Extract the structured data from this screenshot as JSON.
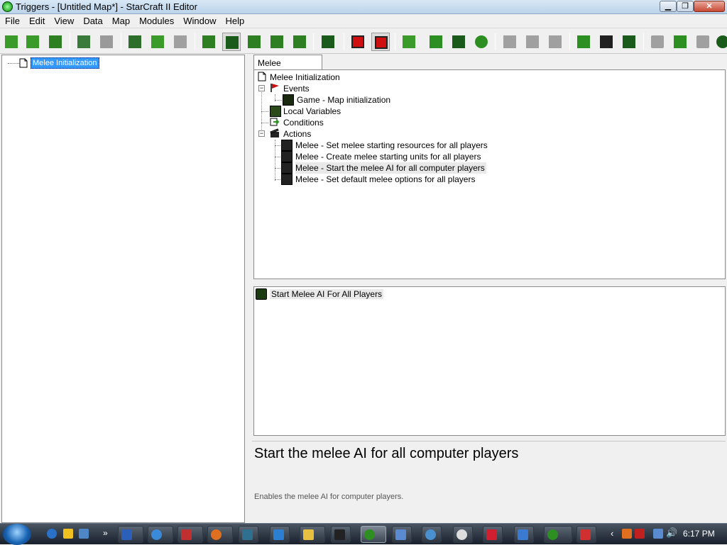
{
  "window": {
    "title": "Triggers - [Untitled Map*] - StarCraft II Editor"
  },
  "menu": [
    "File",
    "Edit",
    "View",
    "Data",
    "Map",
    "Modules",
    "Window",
    "Help"
  ],
  "toolbar": {
    "buttons": [
      {
        "name": "new-trigger",
        "icon": "page-green-icon",
        "color": "#3a9a2a"
      },
      {
        "name": "open",
        "icon": "folder-open-icon",
        "color": "#3a9a2a"
      },
      {
        "name": "save",
        "icon": "disk-save-icon",
        "color": "#2d7f22"
      },
      {
        "name": "undo",
        "icon": "undo-arrow-icon",
        "color": "#3a7a3a"
      },
      {
        "name": "redo",
        "icon": "redo-arrow-icon",
        "color": "#9a9a9a"
      },
      {
        "name": "cut",
        "icon": "scissors-icon",
        "color": "#2d6f2a"
      },
      {
        "name": "copy",
        "icon": "copy-icon",
        "color": "#3a9a2a"
      },
      {
        "name": "paste",
        "icon": "paste-icon",
        "color": "#a0a0a0"
      },
      {
        "name": "terrain",
        "icon": "terrain-icon",
        "color": "#2d7f22"
      },
      {
        "name": "triggers",
        "icon": "trigger-module-icon",
        "color": "#1a5a1a"
      },
      {
        "name": "data",
        "icon": "data-module-icon",
        "color": "#2d7f22"
      },
      {
        "name": "text",
        "icon": "text-a-icon",
        "color": "#2d7f22"
      },
      {
        "name": "import",
        "icon": "import-icon",
        "color": "#2d7f22"
      },
      {
        "name": "ai",
        "icon": "ai-module-icon",
        "color": "#1a5a1a"
      },
      {
        "name": "stop",
        "icon": "stop-red-icon",
        "color": "#d01010"
      },
      {
        "name": "stop-pressed",
        "icon": "stop-red-icon",
        "color": "#d01010"
      },
      {
        "name": "new-element",
        "icon": "page-green-icon",
        "color": "#3a9a2a"
      },
      {
        "name": "new-folder",
        "icon": "folder-icon",
        "color": "#2d8f22"
      },
      {
        "name": "new-action-def",
        "icon": "list-icon",
        "color": "#1a5a1a"
      },
      {
        "name": "new-function",
        "icon": "function-icon",
        "color": "#2d8f22"
      },
      {
        "name": "new-event",
        "icon": "flag-icon",
        "color": "#a0a0a0"
      },
      {
        "name": "new-condition",
        "icon": "arrow-right-icon",
        "color": "#a0a0a0"
      },
      {
        "name": "new-action",
        "icon": "clapper-icon",
        "color": "#a0a0a0"
      },
      {
        "name": "new-local-variable",
        "icon": "variable-arrow-icon",
        "color": "#2d8f22"
      },
      {
        "name": "new-action-clapper",
        "icon": "clapper-dark-icon",
        "color": "#202020"
      },
      {
        "name": "new-param",
        "icon": "param-icon",
        "color": "#1a5a1a"
      },
      {
        "name": "disabled-1",
        "icon": "blank-icon",
        "color": "#a0a0a0"
      },
      {
        "name": "new-comment",
        "icon": "comment-a-icon",
        "color": "#2d8f22"
      },
      {
        "name": "disabled-2",
        "icon": "blank-icon",
        "color": "#a0a0a0"
      },
      {
        "name": "globe",
        "icon": "globe-icon",
        "color": "#1a5a1a"
      }
    ]
  },
  "left_pane": {
    "selected": "Melee Initialization"
  },
  "tab": {
    "label": "Melee Initialization"
  },
  "tree": {
    "root": "Melee Initialization",
    "events_label": "Events",
    "event": "Game - Map initialization",
    "local_variables": "Local Variables",
    "conditions": "Conditions",
    "actions_label": "Actions",
    "actions": [
      "Melee - Set melee starting resources for all players",
      "Melee - Create melee starting units for all players",
      "Melee - Start the melee AI for all computer players",
      "Melee - Set default melee options for all players"
    ]
  },
  "element": {
    "label": "Start Melee AI For All Players"
  },
  "description": {
    "title": "Start the melee AI for all computer players",
    "text": "Enables the melee AI for computer players."
  },
  "taskbar": {
    "clock": "6:17 PM"
  },
  "colors": {
    "selection": "#3399ff",
    "accent_green": "#2d8f22",
    "event_red": "#cc1010"
  }
}
